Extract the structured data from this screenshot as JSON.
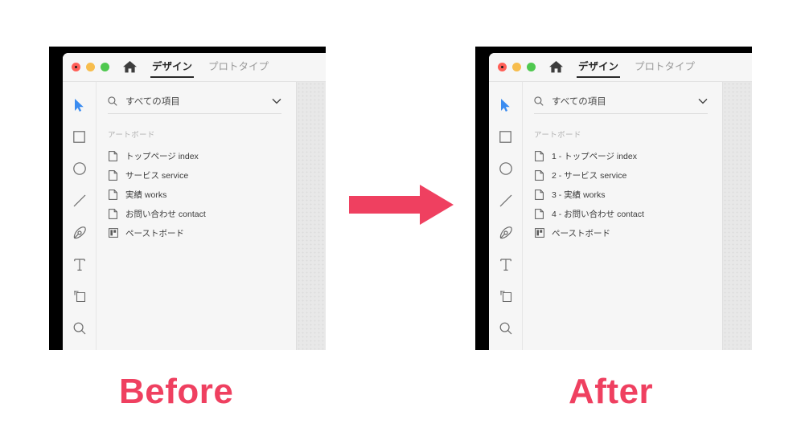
{
  "captions": {
    "before": "Before",
    "after": "After"
  },
  "theme": {
    "accent": "#ef4060",
    "active_tool": "#3b8cf0",
    "panel_bg": "#f6f6f6",
    "canvas_bg": "#e8e8e8",
    "text": "#3b3b3b",
    "muted_text": "#b3b3b3"
  },
  "arrow": {
    "name": "right-arrow",
    "color": "#ef4060",
    "direction": "right"
  },
  "window_before": {
    "traffic_lights": [
      {
        "name": "close-button",
        "color": "#ff5f57"
      },
      {
        "name": "minimize-button",
        "color": "#f7bd4d"
      },
      {
        "name": "maximize-button",
        "color": "#4fc84f"
      }
    ],
    "home_icon": "home-icon",
    "tabs": [
      {
        "label": "デザイン",
        "active": true
      },
      {
        "label": "プロトタイプ",
        "active": false
      }
    ],
    "toolbar": [
      {
        "name": "select-tool",
        "icon": "cursor-icon",
        "active": true
      },
      {
        "name": "rectangle-tool",
        "icon": "rectangle-icon",
        "active": false
      },
      {
        "name": "ellipse-tool",
        "icon": "ellipse-icon",
        "active": false
      },
      {
        "name": "line-tool",
        "icon": "line-icon",
        "active": false
      },
      {
        "name": "pen-tool",
        "icon": "pen-icon",
        "active": false
      },
      {
        "name": "text-tool",
        "icon": "text-icon",
        "active": false
      },
      {
        "name": "artboard-tool",
        "icon": "artboard-icon",
        "active": false
      },
      {
        "name": "zoom-tool",
        "icon": "magnifier-icon",
        "active": false
      }
    ],
    "search": {
      "value": "すべての項目",
      "icon": "search-icon",
      "dropdown_icon": "chevron-down-icon"
    },
    "section_label": "アートボード",
    "layers": [
      {
        "label": "トップページ index",
        "icon": "artboard-page-icon"
      },
      {
        "label": "サービス service",
        "icon": "artboard-page-icon"
      },
      {
        "label": "実績 works",
        "icon": "artboard-page-icon"
      },
      {
        "label": "お問い合わせ contact",
        "icon": "artboard-page-icon"
      },
      {
        "label": "ペーストボード",
        "icon": "pasteboard-icon"
      }
    ]
  },
  "window_after": {
    "traffic_lights": [
      {
        "name": "close-button",
        "color": "#ff5f57"
      },
      {
        "name": "minimize-button",
        "color": "#f7bd4d"
      },
      {
        "name": "maximize-button",
        "color": "#4fc84f"
      }
    ],
    "home_icon": "home-icon",
    "tabs": [
      {
        "label": "デザイン",
        "active": true
      },
      {
        "label": "プロトタイプ",
        "active": false
      }
    ],
    "toolbar": [
      {
        "name": "select-tool",
        "icon": "cursor-icon",
        "active": true
      },
      {
        "name": "rectangle-tool",
        "icon": "rectangle-icon",
        "active": false
      },
      {
        "name": "ellipse-tool",
        "icon": "ellipse-icon",
        "active": false
      },
      {
        "name": "line-tool",
        "icon": "line-icon",
        "active": false
      },
      {
        "name": "pen-tool",
        "icon": "pen-icon",
        "active": false
      },
      {
        "name": "text-tool",
        "icon": "text-icon",
        "active": false
      },
      {
        "name": "artboard-tool",
        "icon": "artboard-icon",
        "active": false
      },
      {
        "name": "zoom-tool",
        "icon": "magnifier-icon",
        "active": false
      }
    ],
    "search": {
      "value": "すべての項目",
      "icon": "search-icon",
      "dropdown_icon": "chevron-down-icon"
    },
    "section_label": "アートボード",
    "layers": [
      {
        "label": "1 - トップページ index",
        "icon": "artboard-page-icon"
      },
      {
        "label": "2 - サービス service",
        "icon": "artboard-page-icon"
      },
      {
        "label": "3 - 実績 works",
        "icon": "artboard-page-icon"
      },
      {
        "label": "4 - お問い合わせ contact",
        "icon": "artboard-page-icon"
      },
      {
        "label": "ペーストボード",
        "icon": "pasteboard-icon"
      }
    ]
  }
}
